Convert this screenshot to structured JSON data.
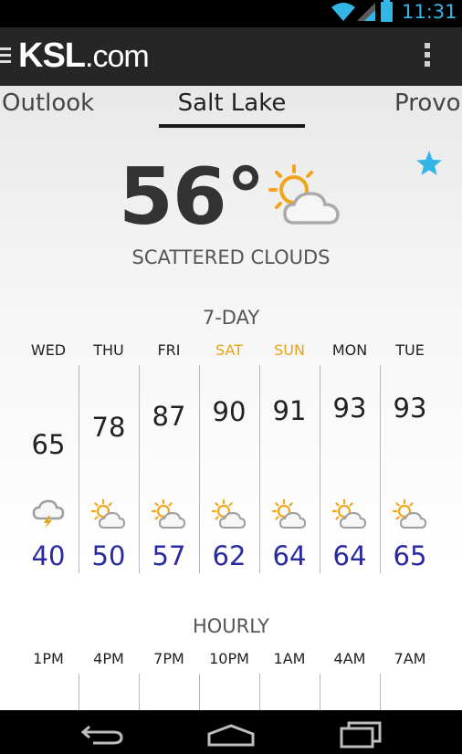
{
  "status_bar": {
    "time": "11:31",
    "icons": [
      "wifi-icon",
      "signal-icon",
      "battery-icon"
    ],
    "accent_color": "#33b5e5"
  },
  "app_bar": {
    "logo_bold": "KSL",
    "logo_rest": ".com",
    "icons": [
      "menu-icon",
      "overflow-menu-icon"
    ]
  },
  "tabs": [
    {
      "label": "Outlook"
    },
    {
      "label": "Salt Lake",
      "selected": true
    },
    {
      "label": "Provo"
    }
  ],
  "current": {
    "temperature": "56°",
    "condition": "SCATTERED CLOUDS",
    "icon": "partly-cloudy-icon",
    "favorite_icon": "star-icon",
    "favorite_color": "#33b5e5"
  },
  "seven_day": {
    "title": "7-DAY",
    "weekend_color": "#e8a317",
    "low_color": "#2a2aa0",
    "days": [
      {
        "day": "WED",
        "high": "65",
        "low": "40",
        "icon": "thunderstorm-icon",
        "weekend": false
      },
      {
        "day": "THU",
        "high": "78",
        "low": "50",
        "icon": "partly-cloudy-icon",
        "weekend": false
      },
      {
        "day": "FRI",
        "high": "87",
        "low": "57",
        "icon": "partly-cloudy-icon",
        "weekend": false
      },
      {
        "day": "SAT",
        "high": "90",
        "low": "62",
        "icon": "partly-cloudy-icon",
        "weekend": true
      },
      {
        "day": "SUN",
        "high": "91",
        "low": "64",
        "icon": "partly-cloudy-icon",
        "weekend": true
      },
      {
        "day": "MON",
        "high": "93",
        "low": "64",
        "icon": "partly-cloudy-icon",
        "weekend": false
      },
      {
        "day": "TUE",
        "high": "93",
        "low": "65",
        "icon": "partly-cloudy-icon",
        "weekend": false
      }
    ]
  },
  "hourly": {
    "title": "HOURLY",
    "hours": [
      "1PM",
      "4PM",
      "7PM",
      "10PM",
      "1AM",
      "4AM",
      "7AM"
    ]
  },
  "nav_bar": {
    "icons": [
      "back-icon",
      "home-icon",
      "recent-apps-icon"
    ]
  }
}
